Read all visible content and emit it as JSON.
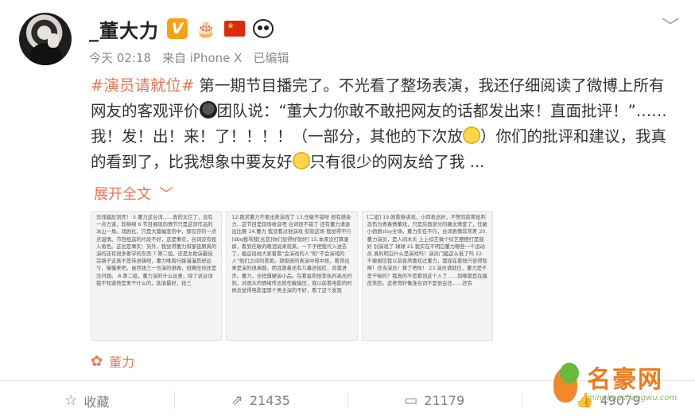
{
  "user": {
    "name": "_董大力",
    "badge": "V",
    "emoji_badge": "🎂"
  },
  "meta": {
    "time": "今天 02:18",
    "source": "来自 iPhone X",
    "edited": "已编辑"
  },
  "post": {
    "hashtag": "#演员请就位#",
    "text1": " 第一期节目播完了。不光看了整场表演，我还仔细阅读了微博上所有网友的客观评价",
    "text2": "团队说：“董大力你敢不敢把网友的话都发出来！直面批评！”……我！发！出！来！了！！！！（一部分，其他的下次放",
    "text3": "）你们的批评和建议，我真的看到了，比我想象中要友好",
    "text4": "只有很少的网友给了我 ...",
    "expand_label": "展开全文"
  },
  "images": [
    {
      "text": "没戏尴尬到死！ 5.董力这台词……真的太烂了，没有一点力道，软绵绵 6.节目展现的情节只是这部作品的冰山一角。戏剧化，只是大篇幅悲伤中，那仅存的一点点温情。节目组选的片段不好，这是事实，台词没有投入角色。这也是事实：另外，我觉得董力和邹佳原真的演的还有很多要学的东西 7.第二组，还是女助演最佳完镜子这真不是带进镜吧，董力唯跨行路漫漫其修远兮，慢慢来吧，虽然钱三一也演的很做，但确压你还是没问题。 8.第二组，董力演的什么玩意，除了说台词我不知道他是来干什么的，助演最好，钱三"
    },
    {
      "text": "12.跪求董力不要出来演戏了 13.任敏不错呀 很有感染力…这节目是现场收音吧 台词很不错了 还有董力请退出比赛 14.董力 我没看过他演戏 但就这场 我觉得不行 [dbq我骂我[允悲]你们觉得好就好] 15.本来没打算录屏，看到任敏的眼泪说来就来。一下子把我代入进去了，截这段给大家看看“会演戏的人”和“不会演戏的人”他们之间的差距。郭俊辰的表演中规中矩，看得出来是演的很鼻酸，而且跟着还有几幕还挺红，尚需进步。董力，全程僵硬演小品。在看蛋和他李执的高光时刻，对观众的情绪传达就任敏输压，我以前看电影的时候总觉得电影里那个男主演的不好，看了这个发现"
    },
    {
      "text": "[二组] 19.刚歌春讲戏，小四表达好，不赞同前辈批判态伤为青春情董戏，只是后面部分的确太情爱了，任敏小姐姐sloy全场，董力实在不行，台词表情非常差 20.董力演员，是人间木头 上上综艺做个综艺摆摆打是鼓 好 别演戏了 球球 21.我实在不明白董力哪些一个运动员 真的明白什么是演戏吗！演员门槛这么低了吗 22.不敢相信我以前竟然喜欢过董力，我现在看他只觉得智障！还当演员！算了吧你！ 23.演员请就位，董力是不是干嘛的？我真的不是看到这个人了……到哪都是在尴皮笑脸。这老哥好像连台词不是很会还……还有"
    }
  ],
  "author_tag": "董力",
  "actions": {
    "favorite": "收藏",
    "repost": "21435",
    "comment": "21179",
    "like": "49079"
  },
  "watermark": {
    "title": "名豪网",
    "url": "minghaoshangwu.com"
  }
}
